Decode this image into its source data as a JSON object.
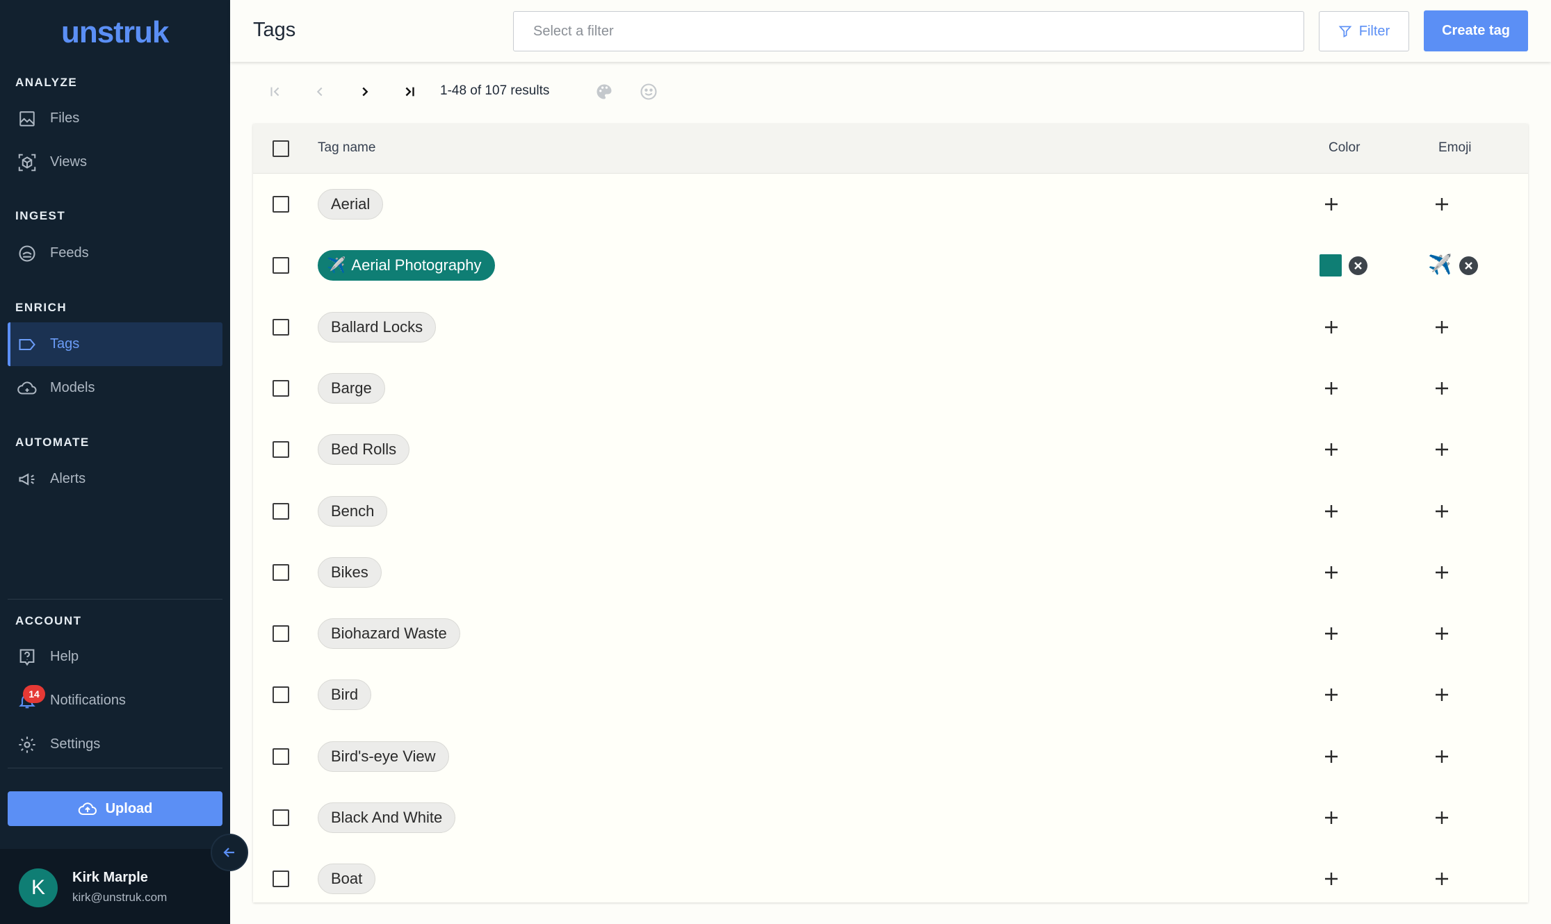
{
  "sidebar": {
    "logo": "unstruk",
    "sections": {
      "analyze": "ANALYZE",
      "ingest": "INGEST",
      "enrich": "ENRICH",
      "automate": "AUTOMATE",
      "account": "ACCOUNT"
    },
    "items": {
      "files": "Files",
      "views": "Views",
      "feeds": "Feeds",
      "tags": "Tags",
      "models": "Models",
      "alerts": "Alerts",
      "help": "Help",
      "notifications": "Notifications",
      "settings": "Settings"
    },
    "notifications_count": "14",
    "upload_label": "Upload",
    "user": {
      "initial": "K",
      "name": "Kirk Marple",
      "email": "kirk@unstruk.com"
    }
  },
  "header": {
    "title": "Tags",
    "filter_placeholder": "Select a filter",
    "filter_label": "Filter",
    "create_label": "Create tag"
  },
  "pager": {
    "results": "1-48 of 107 results"
  },
  "table": {
    "columns": {
      "name": "Tag name",
      "color": "Color",
      "emoji": "Emoji"
    },
    "accent_color": "#0f7e74",
    "rows": [
      {
        "name": "Aerial",
        "color": null,
        "emoji": null
      },
      {
        "name": "Aerial Photography",
        "color": "#0f7e74",
        "emoji": "✈️"
      },
      {
        "name": "Ballard Locks",
        "color": null,
        "emoji": null
      },
      {
        "name": "Barge",
        "color": null,
        "emoji": null
      },
      {
        "name": "Bed Rolls",
        "color": null,
        "emoji": null
      },
      {
        "name": "Bench",
        "color": null,
        "emoji": null
      },
      {
        "name": "Bikes",
        "color": null,
        "emoji": null
      },
      {
        "name": "Biohazard Waste",
        "color": null,
        "emoji": null
      },
      {
        "name": "Bird",
        "color": null,
        "emoji": null
      },
      {
        "name": "Bird's-eye View",
        "color": null,
        "emoji": null
      },
      {
        "name": "Black And White",
        "color": null,
        "emoji": null
      },
      {
        "name": "Boat",
        "color": null,
        "emoji": null
      }
    ]
  }
}
